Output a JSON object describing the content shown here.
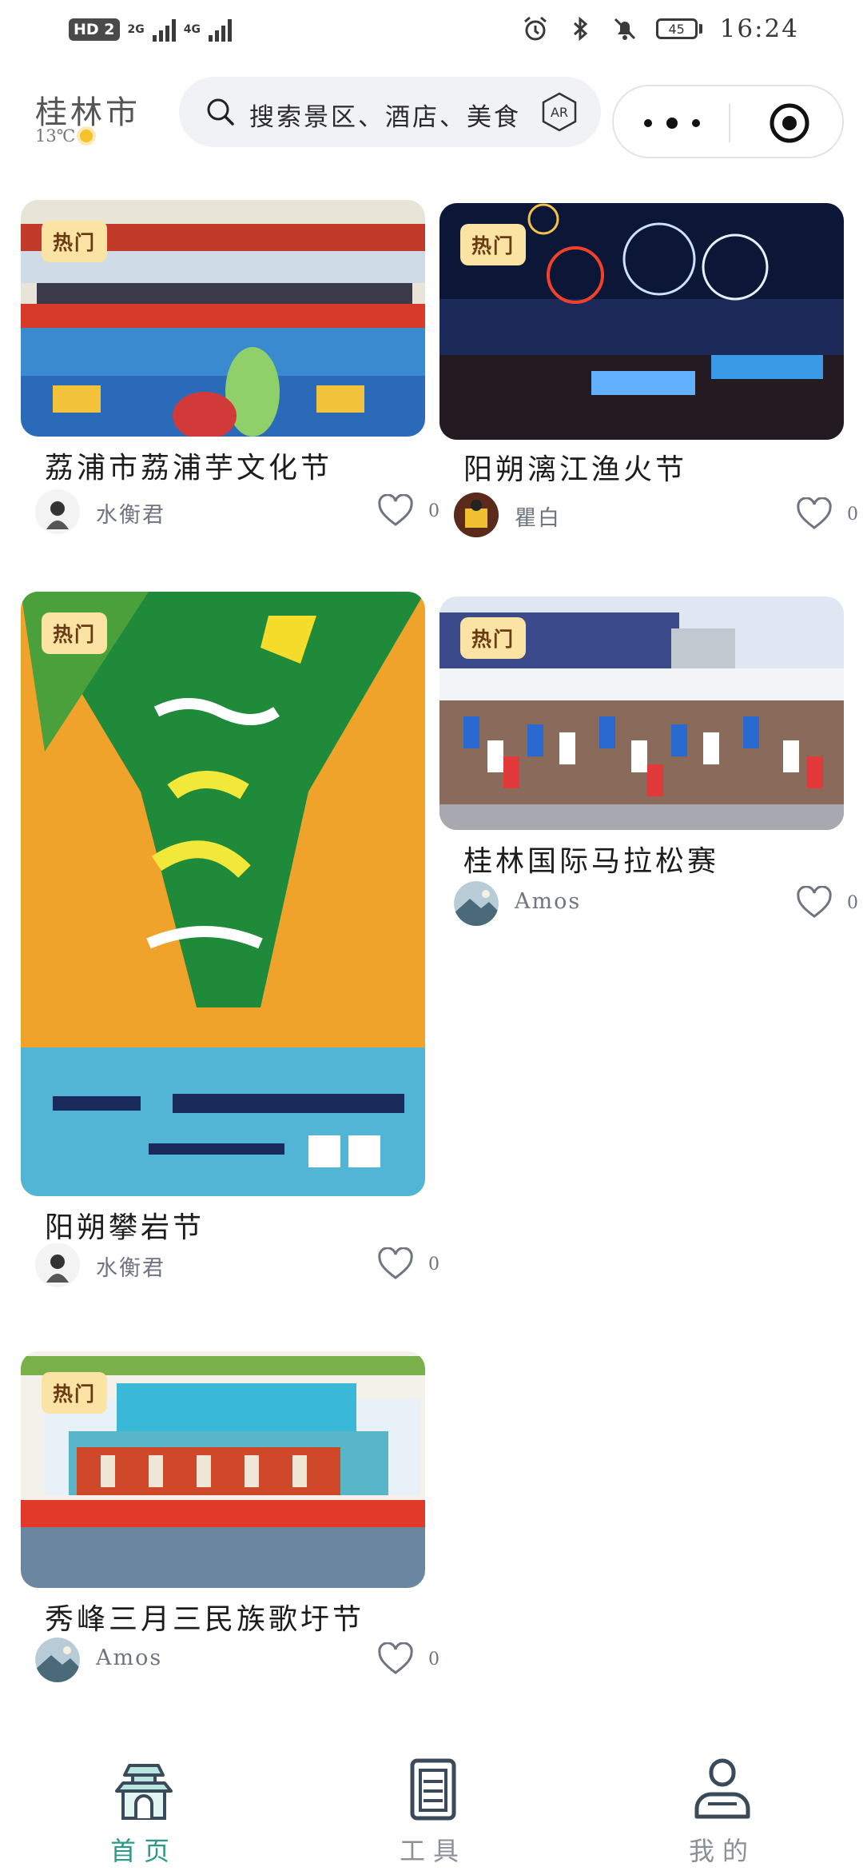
{
  "status_bar": {
    "hd_badge": "HD 2",
    "net1": "2G",
    "net2": "4G",
    "battery": "45",
    "time": "16:24"
  },
  "header": {
    "city": "桂林市",
    "temperature": "13℃",
    "search_placeholder": "搜索景区、酒店、美食",
    "ar_label": "AR"
  },
  "hot_label": "热门",
  "cards": [
    {
      "title": "荔浦市荔浦芋文化节",
      "author": "水衡君",
      "likes": "0"
    },
    {
      "title": "阳朔漓江渔火节",
      "author": "瞿白",
      "likes": "0"
    },
    {
      "title": "阳朔攀岩节",
      "author": "水衡君",
      "likes": "0"
    },
    {
      "title": "桂林国际马拉松赛",
      "author": "Amos",
      "likes": "0"
    },
    {
      "title": "秀峰三月三民族歌圩节",
      "author": "Amos",
      "likes": "0"
    }
  ],
  "tabs": [
    {
      "label": "首页",
      "icon": "home-gate-icon",
      "active": true
    },
    {
      "label": "工具",
      "icon": "tools-doc-icon",
      "active": false
    },
    {
      "label": "我的",
      "icon": "profile-icon",
      "active": false
    }
  ],
  "colors": {
    "accent": "#2c9a86",
    "hot_bg": "#fbe3a4",
    "hot_text": "#6b3a14",
    "muted": "#6f7480"
  }
}
